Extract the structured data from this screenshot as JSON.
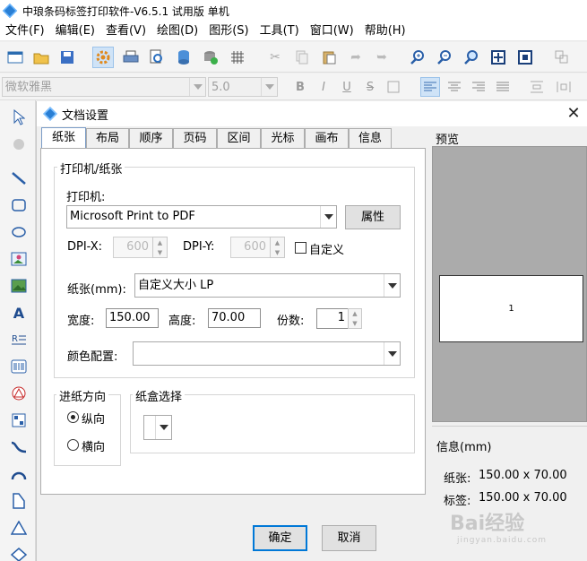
{
  "app": {
    "title": "中琅条码标签打印软件-V6.5.1 试用版 单机"
  },
  "menu": [
    "文件(F)",
    "编辑(E)",
    "查看(V)",
    "绘图(D)",
    "图形(S)",
    "工具(T)",
    "窗口(W)",
    "帮助(H)"
  ],
  "toolbar2": {
    "font_name": "微软雅黑",
    "font_size": "5.0",
    "bold": "B",
    "italic": "I",
    "underline": "U",
    "strike": "S"
  },
  "dialog": {
    "title": "文档设置",
    "close": "✕",
    "tabs": [
      "纸张",
      "布局",
      "顺序",
      "页码",
      "区间",
      "光标",
      "画布",
      "信息"
    ],
    "active_tab": "纸张",
    "printer_group": "打印机/纸张",
    "printer_label": "打印机:",
    "printer_value": "Microsoft Print to PDF",
    "properties_button": "属性",
    "dpix_label": "DPI-X:",
    "dpix_value": "600",
    "dpiy_label": "DPI-Y:",
    "dpiy_value": "600",
    "custom_label": "自定义",
    "paper_label": "纸张(mm):",
    "paper_value": "自定义大小 LP",
    "width_label": "宽度:",
    "width_value": "150.00",
    "height_label": "高度:",
    "height_value": "70.00",
    "copies_label": "份数:",
    "copies_value": "1",
    "color_label": "颜色配置:",
    "color_value": "",
    "feed_group": "进纸方向",
    "portrait": "纵向",
    "landscape": "横向",
    "tray_group": "纸盒选择",
    "tray_value": "",
    "ok_button": "确定",
    "cancel_button": "取消"
  },
  "preview": {
    "title": "预览",
    "page_number": "1",
    "info_title": "信息(mm)",
    "paper_info_label": "纸张:",
    "paper_info_value": "150.00 x 70.00",
    "label_info_label": "标签:",
    "label_info_value": "150.00 x 70.00"
  },
  "watermark": {
    "text": "Bai经验",
    "sub": "jingyan.baidu.com"
  },
  "colors": {
    "accent": "#0078d7",
    "preview_bg": "#ababab",
    "selected_tool": "#cfe3f7"
  }
}
